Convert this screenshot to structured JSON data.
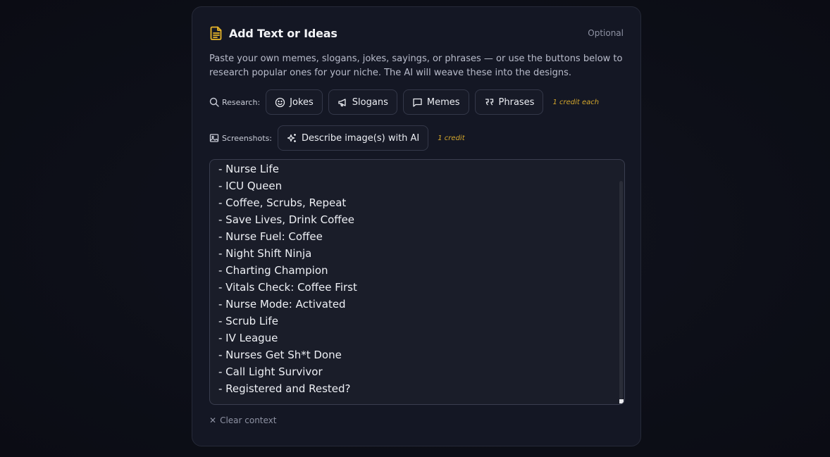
{
  "header": {
    "title": "Add Text or Ideas",
    "optional_label": "Optional",
    "icon": "document-icon"
  },
  "description": "Paste your own memes, slogans, jokes, sayings, or phrases — or use the buttons below to research popular ones for your niche. The AI will weave these into the designs.",
  "research": {
    "label": "Research:",
    "buttons": [
      {
        "label": "Jokes",
        "icon": "smile-icon"
      },
      {
        "label": "Slogans",
        "icon": "megaphone-icon"
      },
      {
        "label": "Memes",
        "icon": "message-icon"
      },
      {
        "label": "Phrases",
        "icon": "quote-icon"
      }
    ],
    "credit_note": "1 credit each"
  },
  "screenshots": {
    "label": "Screenshots:",
    "button_label": "Describe image(s) with AI",
    "credit_note": "1 credit"
  },
  "textarea": {
    "lines": [
      "- Nurse Life",
      "- ICU Queen",
      "- Coffee, Scrubs, Repeat",
      "- Save Lives, Drink Coffee",
      "- Nurse Fuel: Coffee",
      "- Night Shift Ninja",
      "- Charting Champion",
      "- Vitals Check: Coffee First",
      "- Nurse Mode: Activated",
      "- Scrub Life",
      "- IV League",
      "- Nurses Get Sh*t Done",
      "- Call Light Survivor",
      "- Registered and Rested?"
    ]
  },
  "clear_label": "Clear context",
  "colors": {
    "accent": "#e8b62a",
    "credit": "#d4a72c",
    "card_bg": "#141724",
    "page_bg": "#0d0f18"
  }
}
